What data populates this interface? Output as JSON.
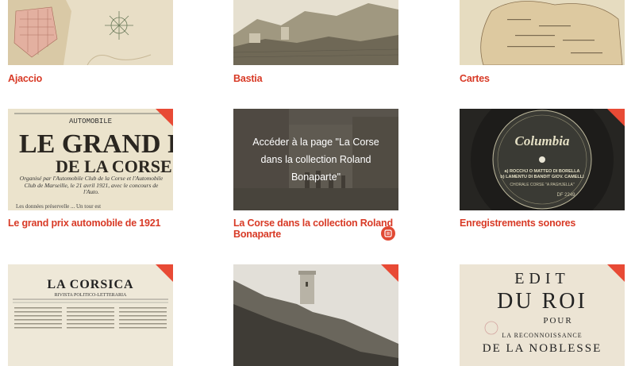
{
  "cards": [
    {
      "title": "Ajaccio",
      "image_alt": "Old map of Ajaccio"
    },
    {
      "title": "Bastia",
      "image_alt": "Engraving of Bastia coast"
    },
    {
      "title": "Cartes",
      "image_alt": "Old map of Corsica"
    },
    {
      "title": "Le grand prix automobile de 1921",
      "image_alt": "Newspaper clipping",
      "clipping": {
        "header": "AUTOMOBILE",
        "headline_line1": "LE GRAND PRIX",
        "headline_line2": "DE LA CORSE",
        "body": "Organisé par l'Automobile Club de la Corse et l'Automobile Club de Marseille, le 21 avril 1921, avec le concours de l'Auto.",
        "footer": "Les données préservelle ... Un tour est"
      }
    },
    {
      "title": "La Corse dans la collection Roland Bonaparte",
      "image_alt": "Old photograph of a Corsican village",
      "overlay_text": "Accéder à la page \"La Corse dans la collection Roland Bonaparte\""
    },
    {
      "title": "Enregistrements sonores",
      "image_alt": "Columbia record label",
      "record": {
        "brand": "Columbia",
        "line1": "a) ROCCHJ O MATTEO DI BORELLA",
        "line2": "b) LAMENTU DI BANDIT GIOV. CAMELLI",
        "artist": "CHORALE CORSE \"A PAGHJELLA\"",
        "catalog": "DF 2249"
      }
    },
    {
      "title": "",
      "image_alt": "La Corsica newspaper",
      "newspaper": {
        "name": "LA CORSICA",
        "subtitle": "RIVISTA POLITICO-LETTERARIA"
      }
    },
    {
      "title": "",
      "image_alt": "Coastal tower photograph"
    },
    {
      "title": "",
      "image_alt": "Edit du Roi document",
      "document": {
        "line1": "EDIT",
        "line2": "DU ROI",
        "line3": "POUR",
        "line4": "LA RECONNOISSANCE",
        "line5": "DE LA NOBLESSE"
      }
    }
  ],
  "colors": {
    "accent": "#d83a26",
    "corner": "#e84a35"
  },
  "icons": {
    "corner": "corner-fold-icon",
    "badge": "media-badge-icon"
  }
}
